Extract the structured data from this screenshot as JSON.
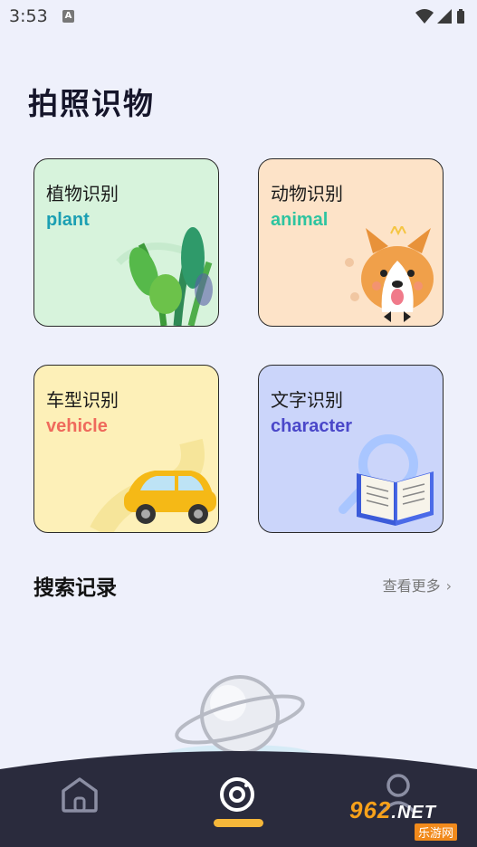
{
  "status_bar": {
    "time": "3:53",
    "notification_glyph": "A"
  },
  "page": {
    "title": "拍照识物"
  },
  "cards": [
    {
      "title": "植物识别",
      "subtitle": "plant",
      "subtitle_color": "#1b9fb3",
      "icon": "plant-icon"
    },
    {
      "title": "动物识别",
      "subtitle": "animal",
      "subtitle_color": "#2ec4a0",
      "icon": "dog-icon"
    },
    {
      "title": "车型识别",
      "subtitle": "vehicle",
      "subtitle_color": "#ef6a5c",
      "icon": "car-icon"
    },
    {
      "title": "文字识别",
      "subtitle": "character",
      "subtitle_color": "#4a47c9",
      "icon": "book-icon"
    }
  ],
  "history": {
    "title": "搜索记录",
    "more_label": "查看更多",
    "more_chevron": "›"
  },
  "nav": {
    "items": [
      "home-icon",
      "scan-icon",
      "profile-icon"
    ],
    "active": "scan-icon",
    "background": "#2a2b3d",
    "active_color": "#f5b73a"
  },
  "watermark": {
    "main": "962",
    "suffix": ".NET",
    "sub": "乐游网"
  }
}
